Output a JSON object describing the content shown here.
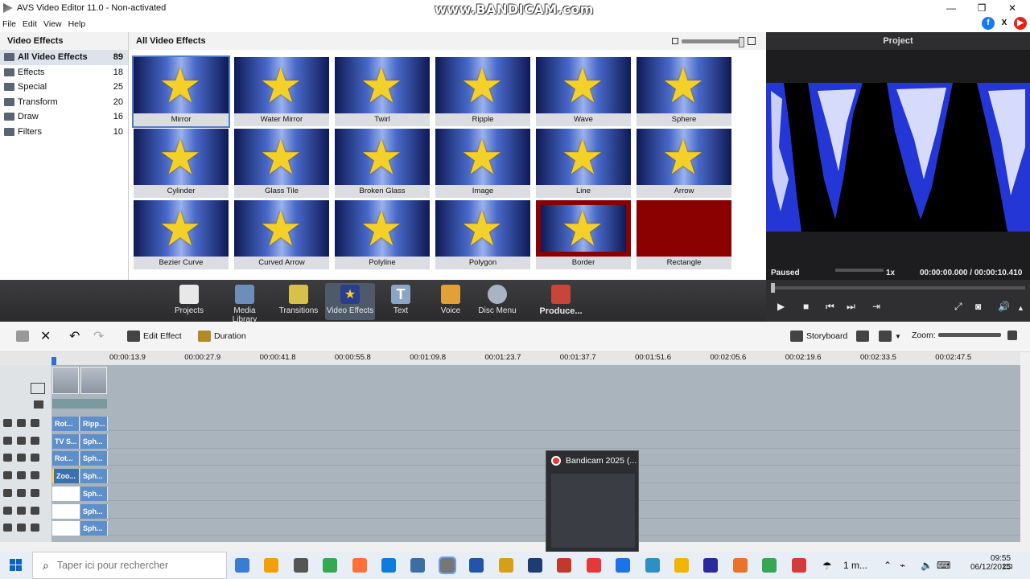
{
  "window": {
    "title": "AVS Video Editor 11.0 - Non-activated",
    "watermark": "www.BANDICAM.com",
    "minimize": "—",
    "restore": "❐",
    "close": "✕"
  },
  "menu": {
    "items": [
      "File",
      "Edit",
      "View",
      "Help"
    ]
  },
  "social": {
    "facebook": "f",
    "x": "X",
    "youtube": "▶"
  },
  "left_panel": {
    "title": "Video Effects",
    "categories": [
      {
        "label": "All Video Effects",
        "count": "89"
      },
      {
        "label": "Effects",
        "count": "18"
      },
      {
        "label": "Special",
        "count": "25"
      },
      {
        "label": "Transform",
        "count": "20"
      },
      {
        "label": "Draw",
        "count": "16"
      },
      {
        "label": "Filters",
        "count": "10"
      }
    ]
  },
  "effects_panel": {
    "title": "All Video Effects",
    "effects": [
      "Mirror",
      "Water Mirror",
      "Twirl",
      "Ripple",
      "Wave",
      "Sphere",
      "Cylinder",
      "Glass Tile",
      "Broken Glass",
      "Image",
      "Line",
      "Arrow",
      "Bezier Curve",
      "Curved Arrow",
      "Polyline",
      "Polygon",
      "Border",
      "Rectangle"
    ]
  },
  "preview": {
    "title": "Project",
    "status": "Paused",
    "speed": "1x",
    "time": "00:00:00.000 / 00:00:10.410"
  },
  "toolbar": {
    "items": [
      {
        "label": "Projects",
        "color": "#e8e8e8"
      },
      {
        "label": "Media Library",
        "color": "#6b8fb8"
      },
      {
        "label": "Transitions",
        "color": "#d8c14a"
      },
      {
        "label": "Video Effects",
        "color": "#2a3f8c"
      },
      {
        "label": "Text",
        "color": "#8aa6c4"
      },
      {
        "label": "Voice",
        "color": "#e2a03a"
      },
      {
        "label": "Disc Menu",
        "color": "#a8b4c4"
      },
      {
        "label": "Produce...",
        "color": "#c8453a"
      }
    ]
  },
  "timeline_toolbar": {
    "edit_effect": "Edit Effect",
    "duration": "Duration",
    "storyboard": "Storyboard",
    "zoom": "Zoom:"
  },
  "ruler": {
    "ticks": [
      "00:00:13.9",
      "00:00:27.9",
      "00:00:41.8",
      "00:00:55.8",
      "00:01:09.8",
      "00:01:23.7",
      "00:01:37.7",
      "00:01:51.6",
      "00:02:05.6",
      "00:02:19.6",
      "00:02:33.5",
      "00:02:47.5"
    ]
  },
  "tracks": {
    "rows": [
      {
        "a": "Rot...",
        "b": "Ripp..."
      },
      {
        "a": "TV S...",
        "b": "Sph..."
      },
      {
        "a": "Rot...",
        "b": "Sph..."
      },
      {
        "a": "Zoo...",
        "b": "Sph..."
      },
      {
        "a": "",
        "b": "Sph..."
      },
      {
        "a": "",
        "b": "Sph..."
      },
      {
        "a": "",
        "b": "Sph..."
      }
    ]
  },
  "bandicam": {
    "title": "Bandicam 2025 (..."
  },
  "taskbar": {
    "search_placeholder": "Taper ici pour rechercher",
    "weather": "1 m...",
    "time": "09:55",
    "date": "06/12/2025",
    "apps": [
      "#3a7bd5",
      "#f59e0b",
      "#555555",
      "#34a853",
      "#ff7139",
      "#0f7bdc",
      "#3a6ea5",
      "#777777",
      "#2255aa",
      "#d4a017",
      "#1f3b73",
      "#c0392b",
      "#e53935",
      "#1a73e8",
      "#2d8fc4",
      "#f1b400",
      "#2a2a9c",
      "#e8732a",
      "#34a853",
      "#d33b3b"
    ]
  }
}
